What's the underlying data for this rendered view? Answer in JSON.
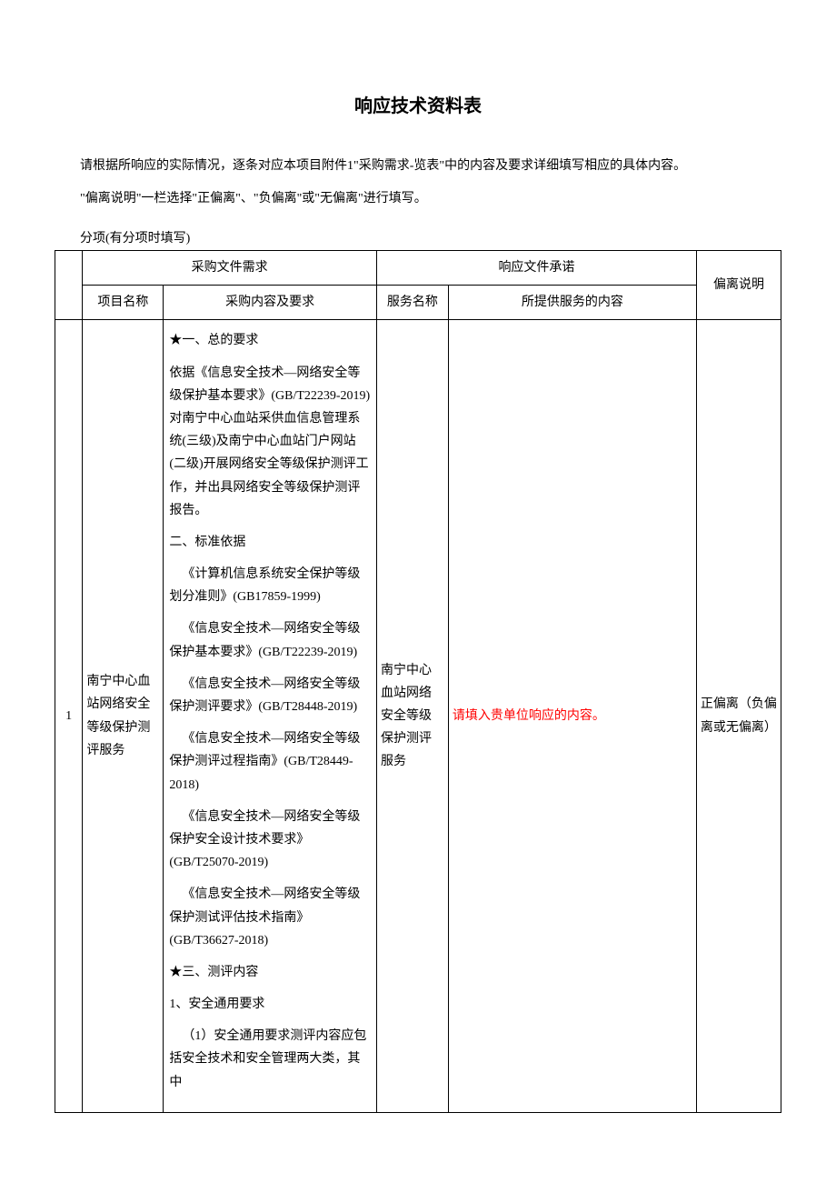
{
  "title": "响应技术资料表",
  "intro_p1": "请根据所响应的实际情况，逐条对应本项目附件1\"采购需求-览表\"中的内容及要求详细填写相应的具体内容。",
  "intro_p2": "\"偏离说明\"一栏选择\"正偏离\"、\"负偏离\"或\"无偏离\"进行填写。",
  "subitem_label": "分项(有分项时填写)",
  "headers": {
    "req_group": "采购文件需求",
    "resp_group": "响应文件承诺",
    "project_name": "项目名称",
    "content_req": "采购内容及要求",
    "service_name": "服务名称",
    "service_content": "所提供服务的内容",
    "deviation": "偏离说明"
  },
  "rows": [
    {
      "num": "1",
      "project_name": "南宁中心血站网络安全等级保护测评服务",
      "requirements": [
        "★一、总的要求",
        "依据《信息安全技术—网络安全等级保护基本要求》(GB/T22239-2019)对南宁中心血站采供血信息管理系统(三级)及南宁中心血站门户网站(二级)开展网络安全等级保护测评工作，并出具网络安全等级保护测评报告。",
        "二、标准依据",
        "《计算机信息系统安全保护等级划分准则》(GB17859-1999)",
        "《信息安全技术—网络安全等级保护基本要求》(GB/T22239-2019)",
        "《信息安全技术—网络安全等级保护测评要求》(GB/T28448-2019)",
        "《信息安全技术—网络安全等级保护测评过程指南》(GB/T28449-2018)",
        "《信息安全技术—网络安全等级保护安全设计技术要求》(GB/T25070-2019)",
        "《信息安全技术—网络安全等级保护测试评估技术指南》(GB/T36627-2018)",
        "★三、测评内容",
        "1、安全通用要求",
        "（1）安全通用要求测评内容应包括安全技术和安全管理两大类，其中"
      ],
      "service_name": "南宁中心血站网络安全等级保护测评服务",
      "response_content": "请填入贵单位响应的内容。",
      "deviation": "正偏离（负偏离或无偏离）"
    }
  ]
}
